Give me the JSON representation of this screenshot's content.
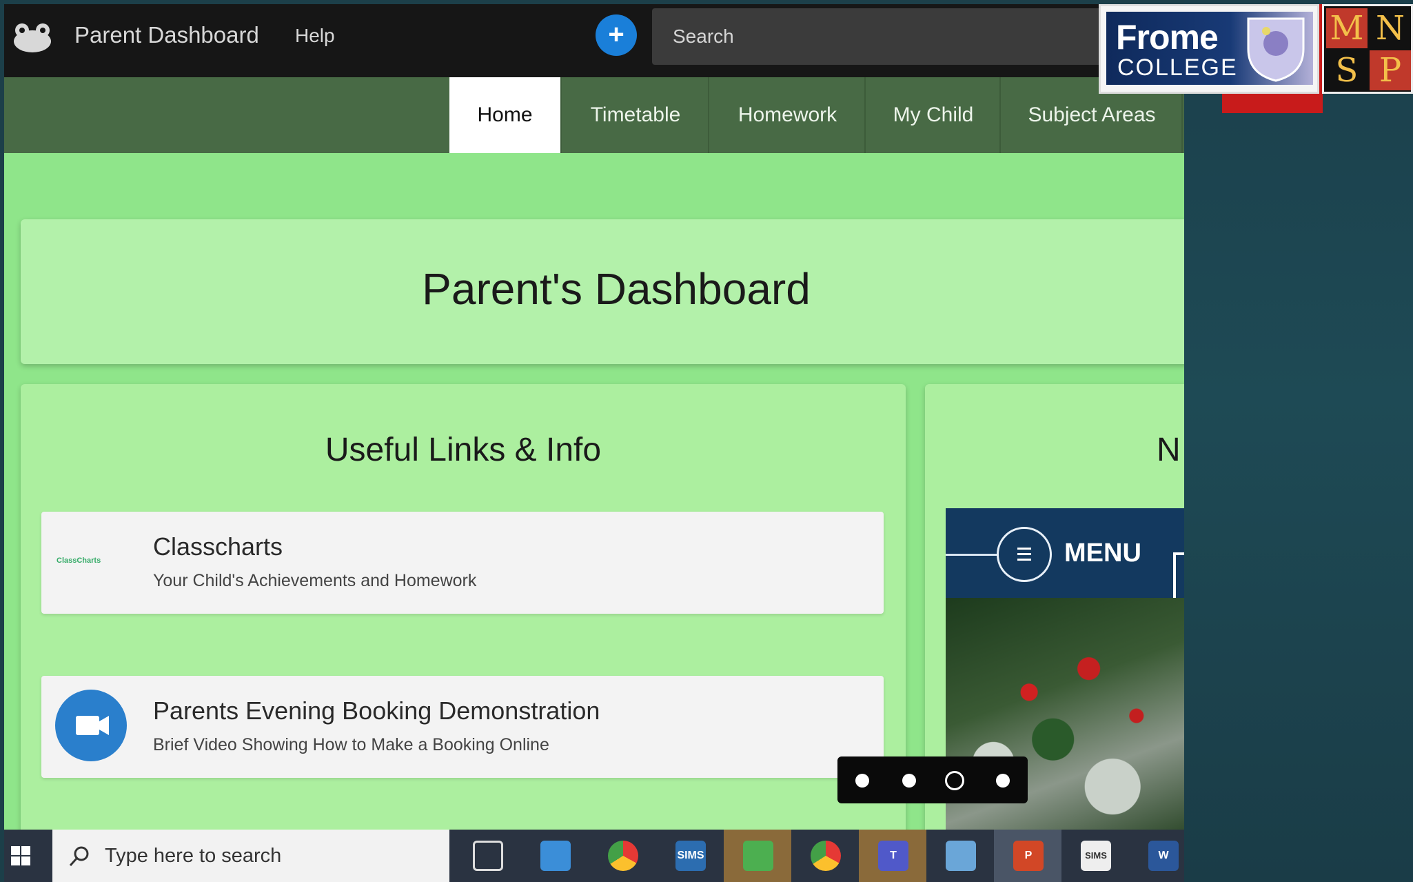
{
  "topbar": {
    "app_title": "Parent Dashboard",
    "help_label": "Help",
    "search_placeholder": "Search"
  },
  "nav": {
    "tabs": [
      {
        "label": "Home",
        "active": true
      },
      {
        "label": "Timetable"
      },
      {
        "label": "Homework"
      },
      {
        "label": "My Child"
      },
      {
        "label": "Subject Areas"
      }
    ]
  },
  "hero": {
    "title": "Parent's Dashboard"
  },
  "links_card": {
    "title": "Useful Links & Info",
    "items": [
      {
        "title": "Classcharts",
        "subtitle": "Your Child's Achievements and Homework",
        "icon": "classcharts-logo",
        "logo_text": "ClassCharts"
      },
      {
        "title": "Parents Evening Booking Demonstration",
        "subtitle": "Brief Video Showing How to Make a Booking Online",
        "icon": "video-camera-icon"
      }
    ]
  },
  "news_card": {
    "title_partial": "N"
  },
  "promo": {
    "menu_label": "MENU"
  },
  "carousel": {
    "dot_count": 4,
    "active_index": 2
  },
  "taskbar": {
    "search_placeholder": "Type here to search",
    "apps": [
      {
        "name": "task-view-icon",
        "label": ""
      },
      {
        "name": "remote-desktop-icon",
        "label": ""
      },
      {
        "name": "chrome-icon",
        "label": ""
      },
      {
        "name": "sims-icon",
        "label": "SIMS"
      },
      {
        "name": "maps-icon",
        "label": ""
      },
      {
        "name": "chrome-profile-icon",
        "label": ""
      },
      {
        "name": "teams-icon",
        "label": "T"
      },
      {
        "name": "photos-icon",
        "label": ""
      },
      {
        "name": "powerpoint-icon",
        "label": "P"
      },
      {
        "name": "sims-icon-2",
        "label": "SIMS"
      },
      {
        "name": "word-icon",
        "label": "W"
      }
    ]
  },
  "branding": {
    "frome_line1": "Frome",
    "frome_line2": "COLLEGE",
    "mnsp_letters": [
      "M",
      "N",
      "S",
      "P"
    ]
  },
  "colors": {
    "page_green": "#8fe58a",
    "card_green": "#acef9f",
    "topbar": "#161616",
    "navbar": "#486a45",
    "accent_blue": "#1a7fd9"
  }
}
